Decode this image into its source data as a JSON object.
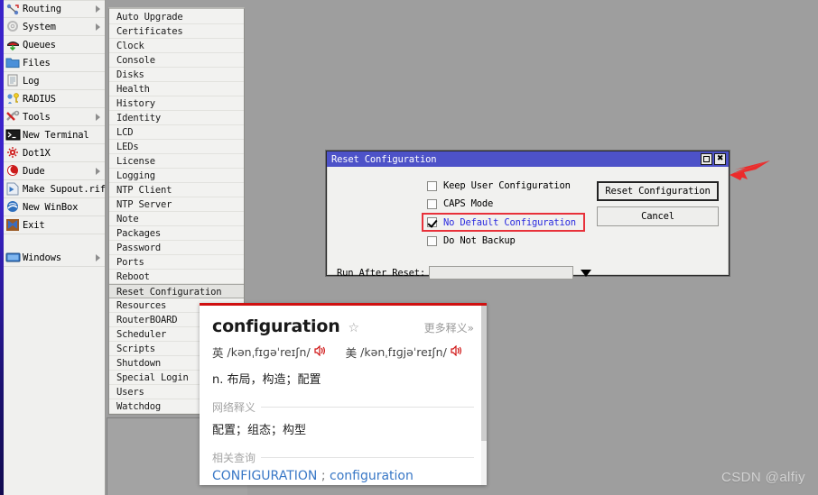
{
  "app": {
    "background_color": "#9e9e9e",
    "accent_title_bar": "#4d52c8"
  },
  "main_menu": {
    "items": [
      {
        "label": "Routing",
        "icon": "routing-icon",
        "has_submenu": true
      },
      {
        "label": "System",
        "icon": "system-gear-icon",
        "has_submenu": true
      },
      {
        "label": "Queues",
        "icon": "queues-icon",
        "has_submenu": false
      },
      {
        "label": "Files",
        "icon": "folder-icon",
        "has_submenu": false
      },
      {
        "label": "Log",
        "icon": "log-icon",
        "has_submenu": false
      },
      {
        "label": "RADIUS",
        "icon": "radius-key-icon",
        "has_submenu": false
      },
      {
        "label": "Tools",
        "icon": "tools-icon",
        "has_submenu": true
      },
      {
        "label": "New Terminal",
        "icon": "terminal-icon",
        "has_submenu": false
      },
      {
        "label": "Dot1X",
        "icon": "dot1x-icon",
        "has_submenu": false
      },
      {
        "label": "Dude",
        "icon": "dude-icon",
        "has_submenu": true
      },
      {
        "label": "Make Supout.rif",
        "icon": "supout-icon",
        "has_submenu": false
      },
      {
        "label": "New WinBox",
        "icon": "winbox-icon",
        "has_submenu": false
      },
      {
        "label": "Exit",
        "icon": "exit-icon",
        "has_submenu": false
      },
      {
        "label": "Windows",
        "icon": "windows-icon",
        "has_submenu": true
      }
    ]
  },
  "system_submenu": {
    "items": [
      {
        "label": "Auto Upgrade",
        "selected": false
      },
      {
        "label": "Certificates",
        "selected": false
      },
      {
        "label": "Clock",
        "selected": false
      },
      {
        "label": "Console",
        "selected": false
      },
      {
        "label": "Disks",
        "selected": false
      },
      {
        "label": "Health",
        "selected": false
      },
      {
        "label": "History",
        "selected": false
      },
      {
        "label": "Identity",
        "selected": false
      },
      {
        "label": "LCD",
        "selected": false
      },
      {
        "label": "LEDs",
        "selected": false
      },
      {
        "label": "License",
        "selected": false
      },
      {
        "label": "Logging",
        "selected": false
      },
      {
        "label": "NTP Client",
        "selected": false
      },
      {
        "label": "NTP Server",
        "selected": false
      },
      {
        "label": "Note",
        "selected": false
      },
      {
        "label": "Packages",
        "selected": false
      },
      {
        "label": "Password",
        "selected": false
      },
      {
        "label": "Ports",
        "selected": false
      },
      {
        "label": "Reboot",
        "selected": false
      },
      {
        "label": "Reset Configuration",
        "selected": true
      },
      {
        "label": "Resources",
        "selected": false
      },
      {
        "label": "RouterBOARD",
        "selected": false
      },
      {
        "label": "Scheduler",
        "selected": false
      },
      {
        "label": "Scripts",
        "selected": false
      },
      {
        "label": "Shutdown",
        "selected": false
      },
      {
        "label": "Special Login",
        "selected": false
      },
      {
        "label": "Users",
        "selected": false
      },
      {
        "label": "Watchdog",
        "selected": false
      }
    ]
  },
  "dialog": {
    "title": "Reset Configuration",
    "maximize_icon": "maximize-icon",
    "close_icon": "close-icon",
    "close_glyph": "✖",
    "checkboxes": [
      {
        "label": "Keep User Configuration",
        "checked": false,
        "highlighted": false
      },
      {
        "label": "CAPS Mode",
        "checked": false,
        "highlighted": false
      },
      {
        "label": "No Default Configuration",
        "checked": true,
        "highlighted": true
      },
      {
        "label": "Do Not Backup",
        "checked": false,
        "highlighted": false
      }
    ],
    "run_after_reset": {
      "label": "Run After Reset:",
      "value": "",
      "placeholder": ""
    },
    "buttons": [
      {
        "label": "Reset Configuration",
        "primary": true
      },
      {
        "label": "Cancel",
        "primary": false
      }
    ],
    "highlight_color": "#e8313a",
    "highlight_text_color": "#2a2adf"
  },
  "annotation": {
    "arrow_icon": "red-arrow-icon",
    "arrow_color": "#ec2b2b"
  },
  "dictionary": {
    "word": "configuration",
    "star_icon": "star-outline-icon",
    "star_glyph": "☆",
    "more_label": "更多释义»",
    "uk": {
      "region": "英",
      "ipa": "/kənˌfɪɡəˈreɪʃn/",
      "speaker_icon": "speaker-icon",
      "speaker_glyph": "🔊"
    },
    "us": {
      "region": "美",
      "ipa": "/kənˌfɪɡjəˈreɪʃn/",
      "speaker_icon": "speaker-icon",
      "speaker_glyph": "🔊"
    },
    "definition": "n. 布局，构造；配置",
    "web_section_title": "网络释义",
    "web_meanings": "配置；组态；构型",
    "related_section_title": "相关查询",
    "related_links": [
      {
        "text": "CONFIGURATION"
      },
      {
        "text": "configuration"
      }
    ],
    "related_separator": ";",
    "top_border_color": "#cf1010",
    "link_color": "#3877c6"
  },
  "watermark": {
    "text": "CSDN @alfiy"
  }
}
